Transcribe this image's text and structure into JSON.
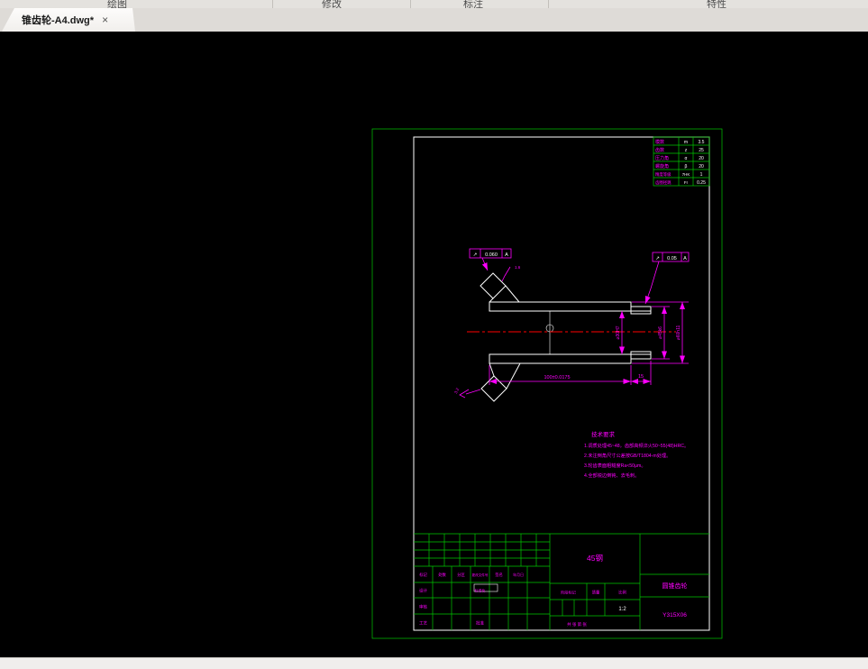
{
  "colors": {
    "sheet_border": "#00c800",
    "frame": "#ffffff",
    "annotation": "#ff00ff",
    "centerline": "#ff0000",
    "hatch": "#2f5cff",
    "canvas_bg": "#000000"
  },
  "ribbon": {
    "panels": [
      {
        "label": "绘图"
      },
      {
        "label": "修改"
      },
      {
        "label": "标注"
      },
      {
        "label": "特性"
      }
    ]
  },
  "tab_bar": {
    "active_tab": "锥齿轮-A4.dwg*",
    "close": "×"
  },
  "param_table": {
    "rows": [
      {
        "label": "模数",
        "symbol": "m",
        "value": "3.5"
      },
      {
        "label": "齿数",
        "symbol": "z",
        "value": "25"
      },
      {
        "label": "压力角",
        "symbol": "α",
        "value": "20"
      },
      {
        "label": "螺旋角",
        "symbol": "β",
        "value": "20"
      },
      {
        "label": "精度等级",
        "symbol": "7HK",
        "value": "1"
      },
      {
        "label": "齿圈径跳",
        "symbol": "Fr",
        "value": "0.25"
      }
    ]
  },
  "drawing": {
    "tolerance_left": {
      "symbol": "↗",
      "value": "0.060",
      "datum": "A"
    },
    "tolerance_right": {
      "symbol": "↗",
      "value": "0.05",
      "datum": "A"
    },
    "dims": {
      "length": "100±0.0175",
      "step": "15",
      "bore": "⌀30H7",
      "hub": "⌀45k6",
      "outer": "⌀60h11",
      "finish_top": "1.6",
      "finish_left": "3.2"
    }
  },
  "tech_notes": {
    "title": "技术要求",
    "lines": [
      "1.调质处理45~48，齿部高频淬火50~55(48)HRC。",
      "2.未注倒角尺寸公差按GB/T1804-m处理。",
      "3.轮齿表面粗糙度Ra<50μm。",
      "4.全部锐边倒钝、去毛刺。"
    ]
  },
  "title_block": {
    "material": "45钢",
    "part_title": "圆锥齿轮",
    "drawing_no": "Y315X06",
    "scale": "1:2",
    "rev_header": {
      "mark": "标记",
      "count": "处数",
      "zone": "分区",
      "doc_no": "更改文件号",
      "sign": "签名",
      "date": "年月日"
    },
    "roles": {
      "design": "设计",
      "standard": "标准化",
      "check": "审核",
      "process": "工艺",
      "approve": "批准"
    },
    "stage": {
      "stage_mark": "阶段标记",
      "weight": "质量",
      "scale_label": "比例"
    },
    "sheets": "共  张  第  张"
  }
}
